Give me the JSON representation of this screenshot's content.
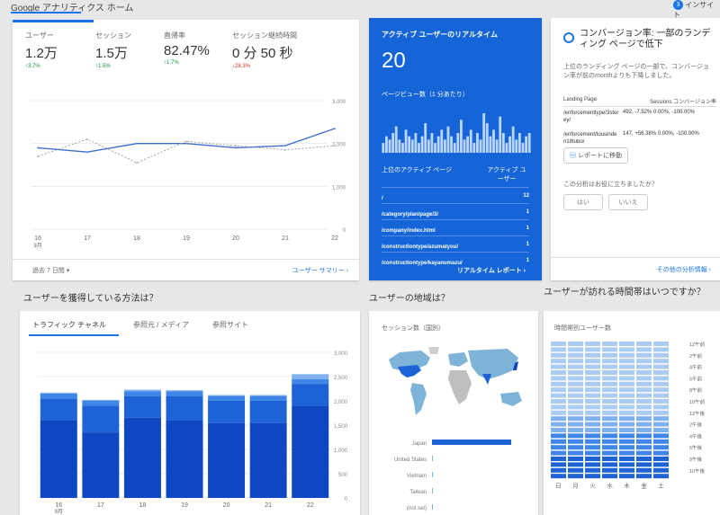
{
  "header": {
    "title": "Google アナリティクス ホーム",
    "insight": "インサイト",
    "insight_badge": "3"
  },
  "overview": {
    "metrics": [
      {
        "label": "ユーザー",
        "value": "1.2万",
        "change": "↑3.7%",
        "dir": "up"
      },
      {
        "label": "セッション",
        "value": "1.5万",
        "change": "↑1.5%",
        "dir": "up"
      },
      {
        "label": "直帰率",
        "value": "82.47%",
        "change": "↑1.7%",
        "dir": "up"
      },
      {
        "label": "セッション継続時間",
        "value": "0 分 50 秒",
        "change": "↓28.3%",
        "dir": "down"
      }
    ],
    "date_range": "過去 7 日間 ▾",
    "report_link": "ユーザー サマリー",
    "month_label": "9月"
  },
  "chart_data": [
    {
      "type": "line",
      "categories": [
        "16",
        "17",
        "18",
        "19",
        "20",
        "21",
        "22"
      ],
      "series": [
        {
          "name": "",
          "values": [
            1900,
            1800,
            2000,
            2000,
            1900,
            1950,
            2350
          ]
        },
        {
          "name": "",
          "values": [
            1700,
            2100,
            1550,
            2050,
            1950,
            1850,
            1950
          ]
        }
      ],
      "yticks": [
        "0",
        "1,000",
        "2,000",
        "3,000"
      ],
      "ylim": [
        0,
        3000
      ]
    },
    {
      "type": "bar",
      "categories": [
        "16",
        "17",
        "18",
        "19",
        "20",
        "21",
        "22"
      ],
      "series": [
        {
          "name": "",
          "values": [
            1600,
            1350,
            1650,
            1600,
            1550,
            1550,
            1900
          ]
        },
        {
          "name": "",
          "values": [
            450,
            550,
            450,
            500,
            450,
            450,
            450
          ]
        },
        {
          "name": "",
          "values": [
            100,
            100,
            100,
            100,
            100,
            100,
            100
          ]
        },
        {
          "name": "",
          "values": [
            20,
            20,
            30,
            20,
            20,
            20,
            100
          ]
        }
      ],
      "yticks": [
        "0",
        "500",
        "1,000",
        "1,500",
        "2,000",
        "2,500",
        "3,000"
      ],
      "ylim": [
        0,
        3000
      ]
    },
    {
      "type": "bar",
      "title": "セッション数（国別）",
      "categories": [
        "Japan",
        "United States",
        "Vietnam",
        "Taiwan",
        "(not set)"
      ],
      "values": [
        100,
        1,
        0.5,
        0.5,
        0.5
      ]
    },
    {
      "type": "heatmap",
      "title": "時間帯別ユーザー数",
      "x": [
        "日",
        "月",
        "火",
        "水",
        "木",
        "金",
        "土"
      ],
      "y_labels": [
        "12午前",
        "2午前",
        "4午前",
        "6午前",
        "8午前",
        "10午前",
        "12午後",
        "2午後",
        "4午後",
        "6午後",
        "8午後",
        "10午後"
      ]
    }
  ],
  "realtime": {
    "title": "アクティブ ユーザーのリアルタイム",
    "count": "20",
    "pv_label": "ページビュー数（1 分あたり）",
    "pv_bars": [
      3,
      5,
      4,
      6,
      8,
      4,
      3,
      7,
      5,
      4,
      6,
      3,
      5,
      9,
      4,
      6,
      3,
      5,
      7,
      4,
      8,
      5,
      3,
      6,
      10,
      4,
      5,
      7,
      3,
      6,
      4,
      12,
      9,
      5,
      7,
      4,
      11,
      6,
      3,
      5,
      8,
      4,
      6,
      3,
      5,
      6
    ],
    "table_head": [
      "上位のアクティブ ページ",
      "アクティブ ユーザー"
    ],
    "rows": [
      {
        "page": "/",
        "users": "12"
      },
      {
        "page": "/category/plan/page/3/",
        "users": "1"
      },
      {
        "page": "/company/index.html",
        "users": "1"
      },
      {
        "page": "/constructiontype/azumatyou/",
        "users": "1"
      },
      {
        "page": "/constructiontype/kayanumazu/",
        "users": "1"
      }
    ],
    "report_link": "リアルタイム レポート"
  },
  "insight_card": {
    "title": "コンバージョン率: 一部のランディング ページで低下",
    "desc": "上位のランディング ページの一部で、コンバージョン率が前のmonthよりも下降しました。",
    "col_heads": [
      "Landing Page",
      "Sessions コンバージョン率"
    ],
    "rows": [
      {
        "page": "/enforcementtype/3storey/",
        "vals": "492, -7.52% 0.00%, -100.00%"
      },
      {
        "page": "/enforcement/tousinden18tubo/",
        "vals": "147, +56.38% 0.00%, -100.00%"
      }
    ],
    "report_button": "レポートに移動",
    "feedback_q": "この分析はお役に立ちましたか？",
    "yes": "はい",
    "no": "いいえ",
    "more_link": "その他の分析情報"
  },
  "acquisition": {
    "heading": "ユーザーを獲得している方法は？",
    "tabs": [
      "トラフィック チャネル",
      "参照元 / メディア",
      "参照サイト"
    ],
    "month_label": "9月"
  },
  "geo": {
    "heading": "ユーザーの地域は？"
  },
  "time": {
    "heading": "ユーザーが訪れる時間帯はいつですか？"
  },
  "colors": {
    "accent": "#1a73e8",
    "realtime_bg": "#1565d8",
    "bar_dark": "#0d47c2",
    "bar_mid": "#1e63d6",
    "bar_light": "#3f86e8",
    "bar_pale": "#7fb0f0"
  }
}
